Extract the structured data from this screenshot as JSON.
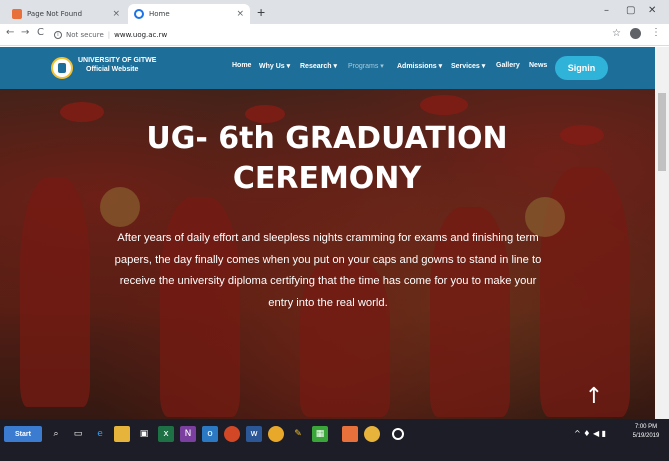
{
  "browser": {
    "tabs": [
      {
        "title": "Page Not Found",
        "close": "×",
        "active": false
      },
      {
        "title": "Home",
        "close": "×",
        "active": true
      }
    ],
    "new_tab": "+",
    "window_controls": {
      "minimize": "–",
      "maximize": "▢",
      "close": "✕"
    },
    "nav": {
      "back": "←",
      "forward": "→",
      "reload": "C"
    },
    "address": {
      "security": "Not secure",
      "separator": "|",
      "url": "www.uog.ac.rw"
    },
    "star": "☆",
    "menu": "⋮"
  },
  "site": {
    "brand_line1": "UNIVERSITY OF GITWE",
    "brand_line2": "Official Website",
    "menu": [
      {
        "label": "Home"
      },
      {
        "label": "Why Us ▾"
      },
      {
        "label": "Research ▾"
      },
      {
        "label": "Programs ▾"
      },
      {
        "label": "Admissions ▾"
      },
      {
        "label": "Services ▾"
      },
      {
        "label": "Gallery"
      },
      {
        "label": "News"
      }
    ],
    "signin": "Signin"
  },
  "hero": {
    "title_line1": "UG- 6th GRADUATION",
    "title_line2": "CEREMONY",
    "paragraph": "After years of daily effort and sleepless nights cramming for exams and finishing term papers, the day finally comes when you put on your caps and gowns to stand in line to receive the university diploma certifying that the time has come for you to make your entry into the real world.",
    "scroll_top_icon": "↑"
  },
  "taskbar": {
    "start_label": "Start",
    "tray_text": "^ ♦ ◀ ▮",
    "time": "7:00 PM",
    "date": "5/19/2019",
    "colors": {
      "taskbar": "#1c1d26",
      "start": "#3b7bd0",
      "navbar": "#1d6f9a",
      "signin": "#2fb3d9"
    }
  }
}
